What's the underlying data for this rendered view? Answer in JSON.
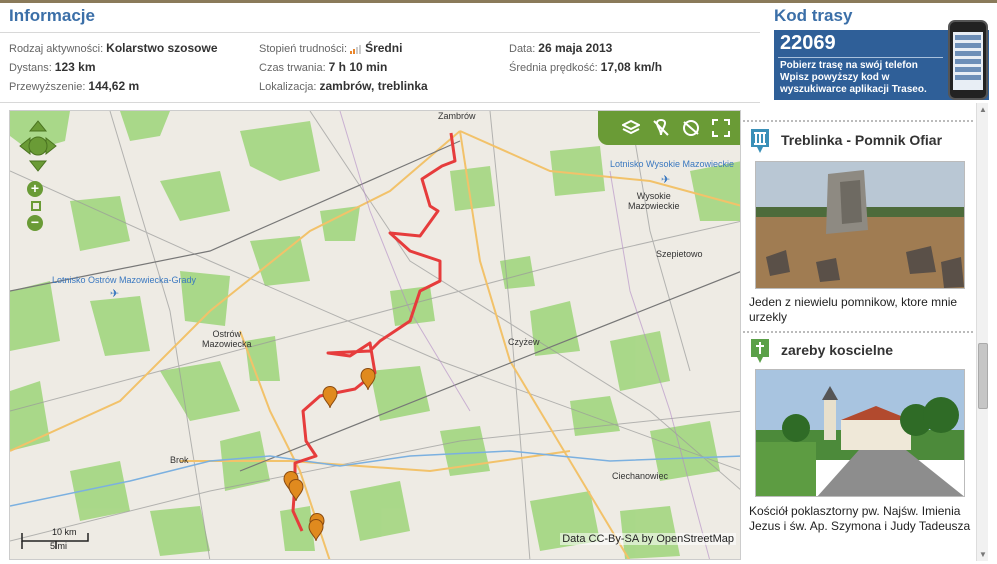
{
  "info": {
    "title": "Informacje",
    "fields": {
      "activity_label": "Rodzaj aktywności:",
      "activity_value": "Kolarstwo szosowe",
      "distance_label": "Dystans:",
      "distance_value": "123 km",
      "elevation_label": "Przewyższenie:",
      "elevation_value": "144,62 m",
      "difficulty_label": "Stopień trudności:",
      "difficulty_value": "Średni",
      "duration_label": "Czas trwania:",
      "duration_value": "7 h 10 min",
      "location_label": "Lokalizacja:",
      "location_value": "zambrów, treblinka",
      "date_label": "Data:",
      "date_value": "26 maja 2013",
      "speed_label": "Średnia prędkość:",
      "speed_value": "17,08 km/h"
    }
  },
  "kod": {
    "title": "Kod trasy",
    "number": "22069",
    "line1": "Pobierz trasę na swój telefon",
    "line2": "Wpisz powyższy kod w wyszukiwarce aplikacji Traseo."
  },
  "map": {
    "towns": {
      "zambrow": "Zambrów",
      "wysokie": "Wysokie\nMazowieckie",
      "szepietowo": "Szepietowo",
      "ostrow": "Ostrów\nMazowiecka",
      "czyzew": "Czyżew",
      "brok": "Brok",
      "ciechanowiec": "Ciechanowiec"
    },
    "airports": {
      "wysokie": "Lotnisko Wysokie Mazowieckie",
      "ostrow": "Lotnisko Ostrów Mazowiecka-Grady"
    },
    "attribution": "Data CC-By-SA by OpenStreetMap",
    "scale_km": "10 km",
    "scale_mi": "5 mi",
    "zoom_in": "+",
    "zoom_out": "−",
    "colors": {
      "route": "#e63c3c",
      "forest": "#a6d785",
      "toolbar": "#6a9b36",
      "marker": "#e08a1e"
    }
  },
  "sidebar": {
    "poi1": {
      "title": "Treblinka - Pomnik Ofiar",
      "desc": "Jeden z niewielu pomnikow, ktore mnie urzekly",
      "icon": "monument-icon"
    },
    "poi2": {
      "title": "zareby koscielne",
      "desc": "Kościół poklasztorny pw. Najśw. Imienia Jezus i św. Ap. Szymona i Judy Tadeusza",
      "icon": "church-icon"
    }
  }
}
